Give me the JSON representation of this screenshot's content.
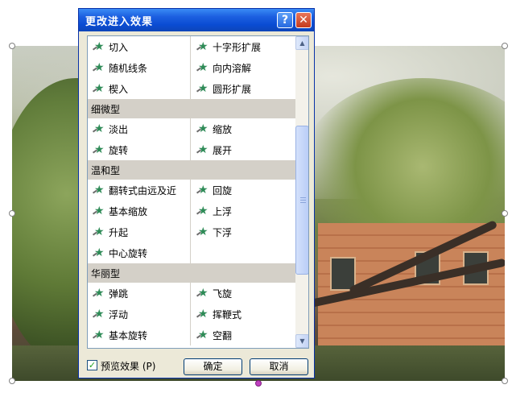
{
  "dialog": {
    "title": "更改进入效果",
    "help_glyph": "?",
    "close_glyph": "✕"
  },
  "effects": {
    "basic_rows": [
      [
        "切入",
        "十字形扩展"
      ],
      [
        "随机线条",
        "向内溶解"
      ],
      [
        "楔入",
        "圆形扩展"
      ]
    ],
    "categories": [
      {
        "name": "细微型",
        "rows": [
          [
            "淡出",
            "缩放"
          ],
          [
            "旋转",
            "展开"
          ]
        ]
      },
      {
        "name": "温和型",
        "rows": [
          [
            "翻转式由远及近",
            "回旋"
          ],
          [
            "基本缩放",
            "上浮"
          ],
          [
            "升起",
            "下浮"
          ],
          [
            "中心旋转",
            ""
          ]
        ]
      },
      {
        "name": "华丽型",
        "rows": [
          [
            "弹跳",
            "飞旋"
          ],
          [
            "浮动",
            "挥鞭式"
          ],
          [
            "基本旋转",
            "空翻"
          ]
        ]
      }
    ]
  },
  "footer": {
    "preview_label": "预览效果",
    "preview_shortcut": "(P)",
    "preview_checked": true,
    "ok_label": "确定",
    "cancel_label": "取消"
  },
  "icons": {
    "effect_star": "★",
    "check": "✓",
    "scroll_up": "▲",
    "scroll_down": "▼"
  },
  "colors": {
    "titlebar": "#0a4cd3",
    "dialog_bg": "#ece9d8",
    "category_bg": "#d4d0c8",
    "star": "#2e8b57"
  }
}
